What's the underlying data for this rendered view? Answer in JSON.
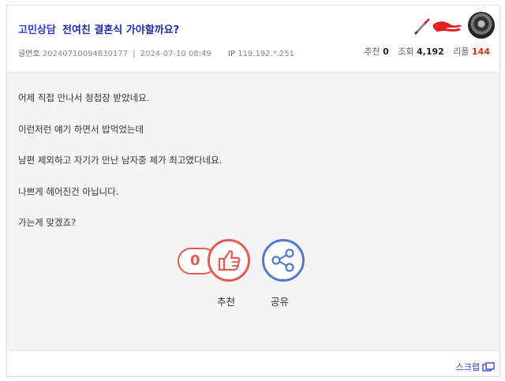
{
  "post": {
    "category": "고민상담",
    "title": "전여친 결혼식 가야할까요?",
    "meta": {
      "number_label": "글번호",
      "number": "20240710094830177",
      "datetime": "2024-07-10 08:49",
      "ip_label": "IP",
      "ip": "119.192.*.251"
    },
    "stats": {
      "recommend_label": "추천",
      "recommend": "0",
      "views_label": "조회",
      "views": "4,192",
      "replies_label": "리플",
      "replies": "144"
    },
    "body": [
      "어제 직접 만나서 청첩장 받았네요.",
      "이런저런 얘기 하면서 밥먹었는데",
      "남편 제외하고 자기가 만난 남자중 제가 최고였다네요.",
      "나쁘게 헤어진건 아닙니다.",
      "가는게 맞겠죠?"
    ]
  },
  "actions": {
    "recommend_count": "0",
    "recommend_label": "추천",
    "share_label": "공유",
    "scrap_label": "스크랩"
  },
  "colors": {
    "accent_red": "#e85a50",
    "accent_blue": "#5277d4",
    "link_blue": "#2b3bd6"
  }
}
